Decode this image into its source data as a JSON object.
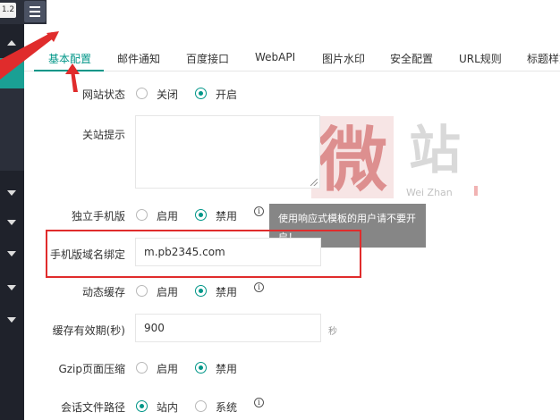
{
  "app": {
    "version": "1.2"
  },
  "tabs": [
    {
      "label": "基本配置",
      "active": true
    },
    {
      "label": "邮件通知"
    },
    {
      "label": "百度接口"
    },
    {
      "label": "WebAPI"
    },
    {
      "label": "图片水印"
    },
    {
      "label": "安全配置"
    },
    {
      "label": "URL规则"
    },
    {
      "label": "标题样式"
    }
  ],
  "form": {
    "site_status": {
      "label": "网站状态",
      "options": [
        "关闭",
        "开启"
      ],
      "selected": "开启"
    },
    "close_notice": {
      "label": "关站提示",
      "value": ""
    },
    "mobile_version": {
      "label": "独立手机版",
      "options": [
        "启用",
        "禁用"
      ],
      "selected": "禁用"
    },
    "mobile_domain": {
      "label": "手机版域名绑定",
      "value": "m.pb2345.com"
    },
    "dynamic_cache": {
      "label": "动态缓存",
      "options": [
        "启用",
        "禁用"
      ],
      "selected": "禁用"
    },
    "cache_ttl": {
      "label": "缓存有效期(秒)",
      "value": "900",
      "unit": "秒"
    },
    "gzip": {
      "label": "Gzip页面压缩",
      "options": [
        "启用",
        "禁用"
      ],
      "selected": "禁用"
    },
    "session_path": {
      "label": "会话文件路径",
      "options": [
        "站内",
        "系统"
      ],
      "selected": "站内"
    }
  },
  "tooltip": {
    "text": "使用响应式模板的用户请不要开启！"
  },
  "watermark": {
    "brand": "Wei Zhan"
  },
  "colors": {
    "accent": "#009688",
    "annotation": "#e02c2c",
    "sidebar": "#1f222b"
  }
}
